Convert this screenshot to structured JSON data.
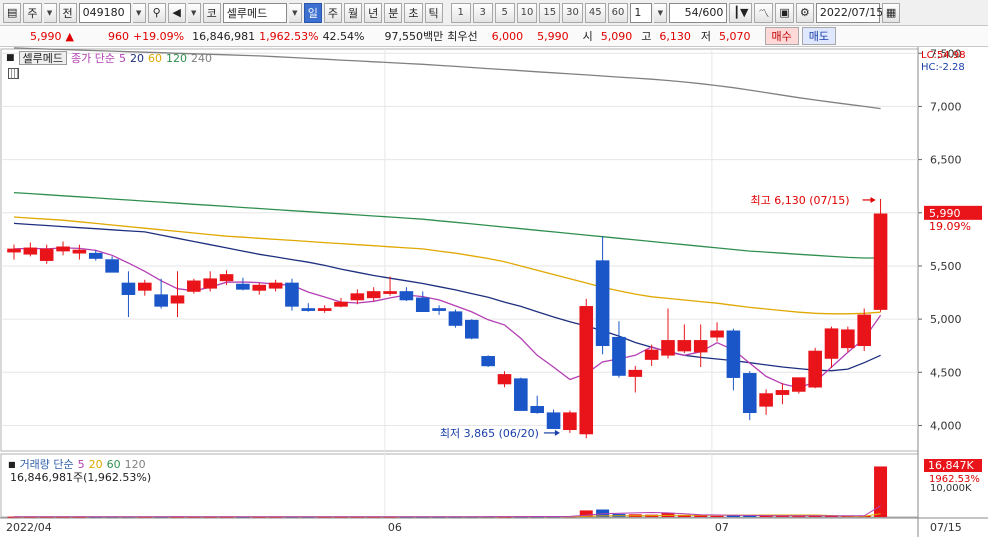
{
  "toolbar": {
    "market": "주",
    "scope": "전",
    "code": "049180",
    "search_icon": "search-icon",
    "sound_icon": "speaker-icon",
    "exchange": "코",
    "name": "셀루메드",
    "periods": [
      "일",
      "주",
      "월",
      "년",
      "분",
      "초",
      "틱"
    ],
    "selected_period": "일",
    "intervals": [
      "1",
      "3",
      "5",
      "10",
      "15",
      "30",
      "45",
      "60"
    ],
    "interval_value": "1",
    "count": "54",
    "count_total": "/600",
    "date": "2022/07/15"
  },
  "quote": {
    "price": "5,990",
    "arrow": "▲",
    "change": "960",
    "change_pct": "+19.09%",
    "volume": "16,846,981",
    "volume_pct": "1,962.53%",
    "turnover_pct": "42.54%",
    "amount": "97,550백만",
    "best_label": "최우선",
    "best_ask": "6,000",
    "best_bid": "5,990",
    "open_label": "시",
    "open": "5,090",
    "high_label": "고",
    "high": "6,130",
    "low_label": "저",
    "low": "5,070",
    "buy_label": "매수",
    "sell_label": "매도"
  },
  "legend": {
    "stock": "셀루메드",
    "ma_label": "종가 단순",
    "ma": [
      "5",
      "20",
      "60",
      "120",
      "240"
    ],
    "vol_label": "거래량 단순",
    "vol_ma": [
      "5",
      "20",
      "60",
      "120"
    ],
    "vol_value": "16,846,981주(1,962.53%)"
  },
  "right_info": {
    "lc": "LC:54.98",
    "hc": "HC:-2.28"
  },
  "annotations": {
    "high": "최고 6,130 (07/15)",
    "low": "최저 3,865 (06/20)"
  },
  "price_tag": {
    "value": "5,990",
    "pct": "19.09%"
  },
  "vol_tag": {
    "value": "16,847K",
    "pct": "1962.53%"
  },
  "colors": {
    "up": "#e8141a",
    "down": "#1a56c8",
    "ma5": "#b43fb4",
    "ma20": "#1f2f7f",
    "ma60": "#e0a800",
    "ma120": "#2f8f4f",
    "ma240": "#808080"
  },
  "chart_data": {
    "type": "candlestick",
    "price_axis": {
      "ticks": [
        "7,500",
        "7,000",
        "6,500",
        "6,000",
        "5,500",
        "5,000",
        "4,500",
        "4,000"
      ],
      "values": [
        7500,
        7000,
        6500,
        6000,
        5500,
        5000,
        4500,
        4000
      ],
      "ylim": [
        3760,
        7540
      ]
    },
    "vol_axis": {
      "ticks": [
        "10,000K"
      ],
      "values": [
        10000
      ]
    },
    "date_labels": [
      {
        "label": "2022/04",
        "index": 0
      },
      {
        "label": "06",
        "index": 23
      },
      {
        "label": "07",
        "index": 43
      },
      {
        "label": "07/15",
        "index": 53
      }
    ],
    "candles": [
      [
        5630,
        5700,
        5560,
        5660
      ],
      [
        5610,
        5720,
        5590,
        5670
      ],
      [
        5550,
        5700,
        5520,
        5660
      ],
      [
        5640,
        5730,
        5600,
        5680
      ],
      [
        5620,
        5700,
        5560,
        5650
      ],
      [
        5620,
        5650,
        5550,
        5570
      ],
      [
        5560,
        5590,
        5440,
        5440
      ],
      [
        5340,
        5450,
        5020,
        5230
      ],
      [
        5270,
        5370,
        5220,
        5340
      ],
      [
        5230,
        5380,
        5100,
        5120
      ],
      [
        5150,
        5450,
        5020,
        5220
      ],
      [
        5260,
        5380,
        5240,
        5360
      ],
      [
        5290,
        5450,
        5260,
        5380
      ],
      [
        5360,
        5460,
        5320,
        5420
      ],
      [
        5330,
        5390,
        5270,
        5280
      ],
      [
        5270,
        5340,
        5230,
        5320
      ],
      [
        5290,
        5370,
        5260,
        5340
      ],
      [
        5340,
        5380,
        5080,
        5120
      ],
      [
        5100,
        5150,
        5070,
        5080
      ],
      [
        5080,
        5130,
        5060,
        5100
      ],
      [
        5120,
        5200,
        5110,
        5160
      ],
      [
        5180,
        5280,
        5140,
        5240
      ],
      [
        5200,
        5300,
        5170,
        5260
      ],
      [
        5240,
        5400,
        5220,
        5260
      ],
      [
        5260,
        5300,
        5170,
        5180
      ],
      [
        5200,
        5260,
        5070,
        5070
      ],
      [
        5100,
        5130,
        5040,
        5080
      ],
      [
        5070,
        5090,
        4920,
        4940
      ],
      [
        4990,
        5000,
        4810,
        4820
      ],
      [
        4650,
        4660,
        4550,
        4560
      ],
      [
        4390,
        4510,
        4360,
        4480
      ],
      [
        4440,
        4450,
        4140,
        4140
      ],
      [
        4180,
        4280,
        4110,
        4120
      ],
      [
        4120,
        4150,
        3970,
        3970
      ],
      [
        3960,
        4140,
        3930,
        4120
      ],
      [
        3920,
        5190,
        3880,
        5120
      ],
      [
        5550,
        5780,
        4670,
        4750
      ],
      [
        4830,
        4980,
        4450,
        4470
      ],
      [
        4460,
        4560,
        4310,
        4520
      ],
      [
        4620,
        4760,
        4560,
        4710
      ],
      [
        4660,
        5100,
        4630,
        4800
      ],
      [
        4700,
        4950,
        4680,
        4800
      ],
      [
        4690,
        4950,
        4550,
        4800
      ],
      [
        4830,
        4970,
        4790,
        4890
      ],
      [
        4890,
        4910,
        4330,
        4450
      ],
      [
        4490,
        4510,
        4050,
        4120
      ],
      [
        4180,
        4340,
        4100,
        4300
      ],
      [
        4290,
        4400,
        4200,
        4330
      ],
      [
        4320,
        4440,
        4300,
        4450
      ],
      [
        4360,
        4730,
        4350,
        4700
      ],
      [
        4630,
        4930,
        4540,
        4910
      ],
      [
        4730,
        4930,
        4690,
        4900
      ],
      [
        4750,
        5100,
        4700,
        5040
      ],
      [
        5090,
        6130,
        5070,
        5990
      ]
    ],
    "volumes": [
      120,
      110,
      100,
      100,
      95,
      100,
      120,
      140,
      110,
      120,
      110,
      100,
      100,
      95,
      90,
      90,
      95,
      120,
      110,
      100,
      95,
      100,
      100,
      105,
      100,
      110,
      100,
      110,
      130,
      160,
      140,
      180,
      200,
      220,
      280,
      2200,
      2500,
      1050,
      900,
      780,
      1350,
      700,
      500,
      400,
      520,
      600,
      350,
      330,
      300,
      480,
      440,
      360,
      380,
      16847
    ],
    "ma5": [
      5660,
      5665,
      5660,
      5670,
      5665,
      5646,
      5600,
      5527,
      5450,
      5360,
      5286,
      5266,
      5300,
      5347,
      5349,
      5343,
      5328,
      5318,
      5254,
      5208,
      5160,
      5152,
      5168,
      5200,
      5227,
      5212,
      5181,
      5124,
      5068,
      4994,
      4946,
      4819,
      4660,
      4549,
      4432,
      4487,
      4598,
      4626,
      4660,
      4740,
      4690,
      4660,
      4693,
      4778,
      4712,
      4586,
      4461,
      4391,
      4354,
      4410,
      4549,
      4688,
      4817,
      5036
    ],
    "ma20": [
      5900,
      5890,
      5880,
      5870,
      5860,
      5850,
      5840,
      5830,
      5820,
      5790,
      5760,
      5730,
      5700,
      5670,
      5640,
      5610,
      5585,
      5560,
      5535,
      5505,
      5470,
      5440,
      5410,
      5385,
      5360,
      5335,
      5305,
      5275,
      5240,
      5205,
      5160,
      5120,
      5070,
      5020,
      4975,
      4935,
      4890,
      4840,
      4780,
      4735,
      4695,
      4660,
      4640,
      4625,
      4610,
      4590,
      4570,
      4550,
      4535,
      4520,
      4515,
      4530,
      4590,
      4660
    ],
    "ma60": [
      5960,
      5950,
      5940,
      5930,
      5915,
      5900,
      5885,
      5870,
      5855,
      5840,
      5825,
      5810,
      5795,
      5780,
      5770,
      5760,
      5750,
      5740,
      5730,
      5720,
      5710,
      5700,
      5690,
      5680,
      5670,
      5660,
      5640,
      5620,
      5595,
      5570,
      5540,
      5500,
      5460,
      5420,
      5380,
      5340,
      5300,
      5265,
      5235,
      5210,
      5195,
      5180,
      5165,
      5150,
      5130,
      5110,
      5095,
      5080,
      5065,
      5055,
      5050,
      5050,
      5055,
      5065
    ],
    "ma120": [
      6190,
      6180,
      6170,
      6160,
      6150,
      6140,
      6130,
      6120,
      6110,
      6100,
      6090,
      6080,
      6070,
      6060,
      6050,
      6040,
      6030,
      6020,
      6010,
      6000,
      5990,
      5980,
      5970,
      5960,
      5950,
      5940,
      5925,
      5910,
      5895,
      5880,
      5865,
      5850,
      5835,
      5820,
      5805,
      5790,
      5775,
      5760,
      5745,
      5730,
      5715,
      5700,
      5685,
      5670,
      5655,
      5640,
      5630,
      5620,
      5610,
      5600,
      5590,
      5580,
      5575,
      5575
    ],
    "ma240": [
      7550,
      7545,
      7540,
      7535,
      7530,
      7525,
      7520,
      7515,
      7510,
      7505,
      7500,
      7495,
      7490,
      7485,
      7480,
      7475,
      7468,
      7460,
      7452,
      7444,
      7436,
      7428,
      7420,
      7412,
      7404,
      7396,
      7386,
      7376,
      7366,
      7356,
      7346,
      7336,
      7326,
      7316,
      7306,
      7296,
      7286,
      7276,
      7266,
      7256,
      7244,
      7230,
      7214,
      7196,
      7176,
      7154,
      7130,
      7106,
      7082,
      7060,
      7040,
      7020,
      7000,
      6980
    ],
    "vol_ma5": [
      110,
      108,
      106,
      105,
      104,
      103,
      105,
      111,
      113,
      116,
      120,
      116,
      112,
      107,
      99,
      97,
      96,
      99,
      101,
      101,
      103,
      105,
      104,
      103,
      100,
      102,
      103,
      105,
      111,
      124,
      130,
      144,
      162,
      180,
      204,
      616,
      1080,
      1230,
      1370,
      1486,
      1356,
      1056,
      746,
      666,
      554,
      544,
      474,
      440,
      420,
      416,
      380,
      384,
      402,
      3685
    ],
    "vol_ma20": [
      105,
      105,
      105,
      105,
      105,
      105,
      106,
      107,
      108,
      108,
      108,
      108,
      109,
      109,
      108,
      108,
      108,
      108,
      108,
      108,
      108,
      108,
      108,
      108,
      108,
      108,
      108,
      108,
      109,
      112,
      114,
      118,
      122,
      128,
      137,
      242,
      362,
      409,
      449,
      482,
      544,
      574,
      594,
      608,
      624,
      645,
      653,
      659,
      662,
      681,
      494,
      290,
      235,
      1057
    ]
  }
}
